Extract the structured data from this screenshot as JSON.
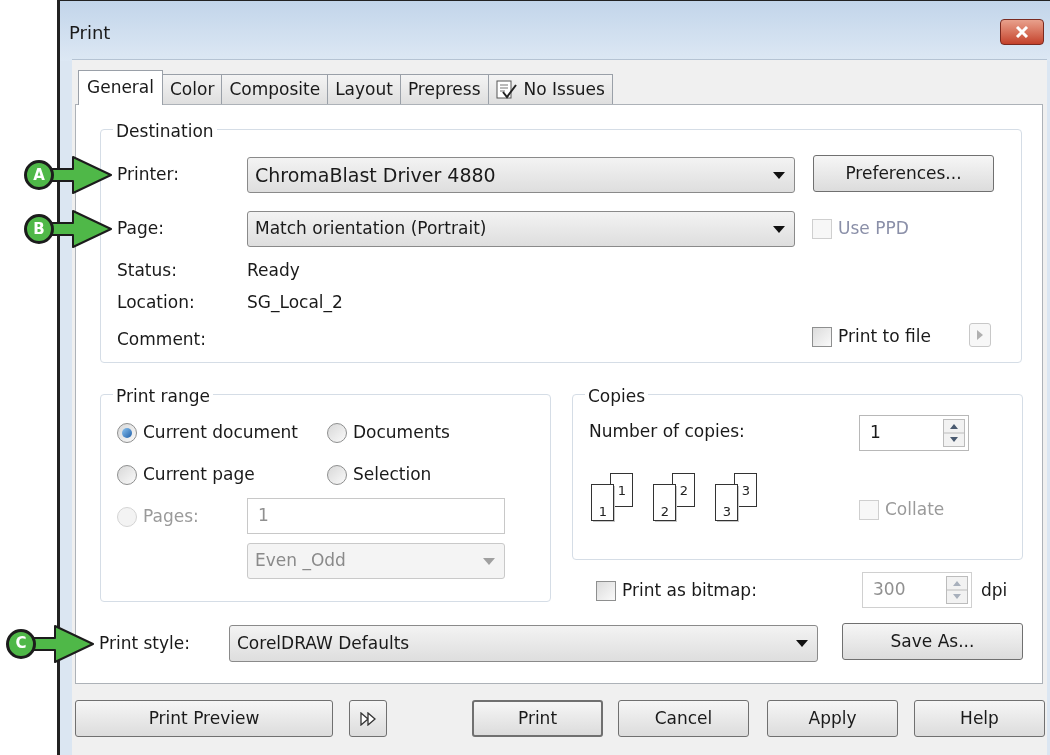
{
  "window": {
    "title": "Print"
  },
  "tabs": [
    {
      "label": "General",
      "selected": true
    },
    {
      "label": "Color",
      "selected": false
    },
    {
      "label": "Composite",
      "selected": false
    },
    {
      "label": "Layout",
      "selected": false
    },
    {
      "label": "Prepress",
      "selected": false
    },
    {
      "label": "No Issues",
      "selected": false,
      "kind": "issues"
    }
  ],
  "destination": {
    "title": "Destination",
    "printer": {
      "label": "Printer:",
      "value": "ChromaBlast Driver 4880",
      "callout": "A"
    },
    "preferences_button": "Preferences...",
    "page": {
      "label": "Page:",
      "value": "Match orientation (Portrait)",
      "callout": "B"
    },
    "use_ppd": {
      "label": "Use PPD",
      "checked": false,
      "disabled": true
    },
    "info": [
      {
        "label": "Status:",
        "value": "Ready"
      },
      {
        "label": "Location:",
        "value": "SG_Local_2"
      },
      {
        "label": "Comment:"
      }
    ],
    "print_to_file": {
      "label": "Print to file",
      "checked": false
    }
  },
  "print_range": {
    "title": "Print range",
    "options": [
      {
        "label": "Current document",
        "selected": true,
        "disabled": false
      },
      {
        "label": "Documents",
        "selected": false,
        "disabled": false
      },
      {
        "label": "Current page",
        "selected": false,
        "disabled": false
      },
      {
        "label": "Selection",
        "selected": false,
        "disabled": false
      },
      {
        "label": "Pages:",
        "selected": false,
        "disabled": true
      }
    ],
    "pages_field": {
      "value": "1",
      "disabled": true
    },
    "parity_dropdown": {
      "value": "Even _Odd",
      "disabled": true
    }
  },
  "copies": {
    "title": "Copies",
    "label": "Number of copies:",
    "value": "1",
    "page_stacks": [
      {
        "back": "1",
        "front": "1"
      },
      {
        "back": "2",
        "front": "2"
      },
      {
        "back": "3",
        "front": "3"
      }
    ],
    "collate": {
      "label": "Collate",
      "checked": false,
      "disabled": true
    }
  },
  "print_as_bitmap": {
    "label": "Print as bitmap:",
    "checked": false,
    "dpi_value": "300",
    "unit": "dpi"
  },
  "print_style": {
    "label": "Print style:",
    "value": "CorelDRAW Defaults",
    "callout": "C",
    "save_button": "Save As..."
  },
  "footer": {
    "preview_button": "Print Preview",
    "buttons": [
      {
        "label": "Print",
        "default": true
      },
      {
        "label": "Cancel",
        "default": false
      },
      {
        "label": "Apply",
        "default": false
      },
      {
        "label": "Help",
        "default": false
      }
    ]
  }
}
